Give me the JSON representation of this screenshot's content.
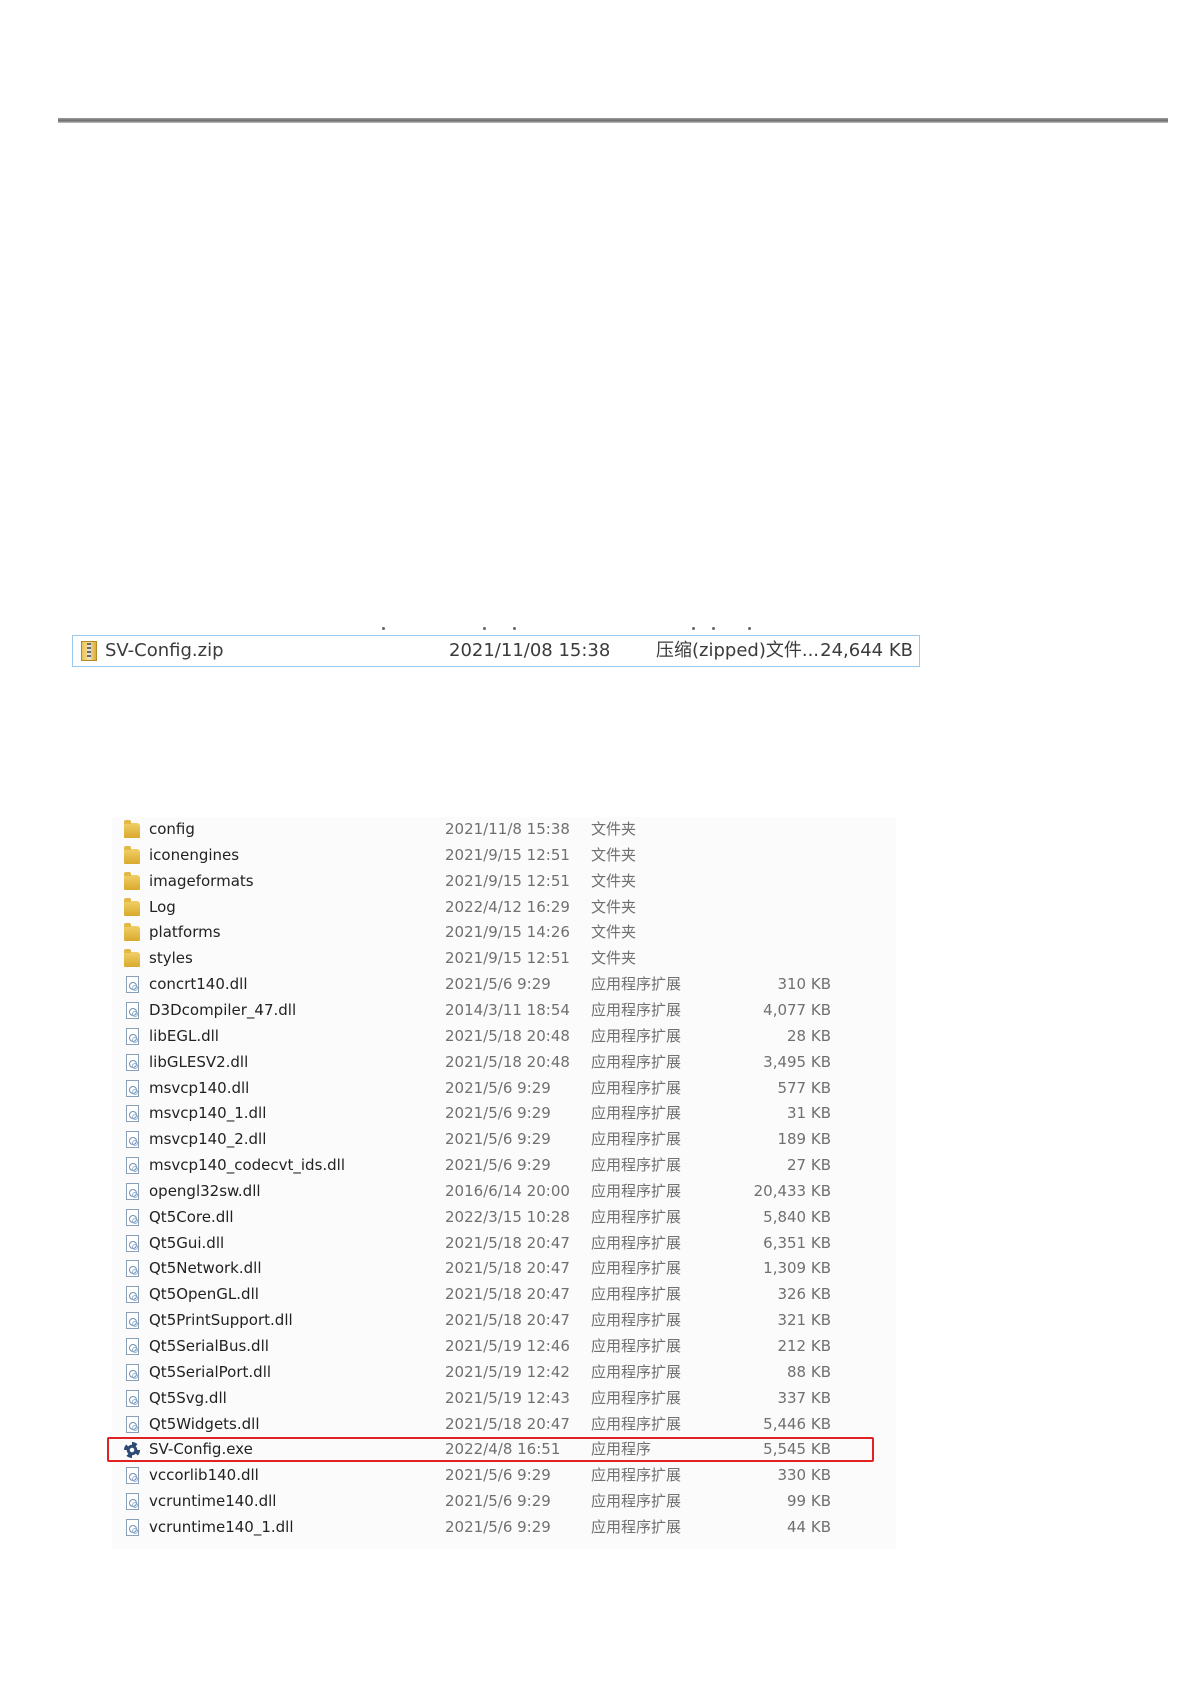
{
  "zip_file": {
    "name": "SV-Config.zip",
    "modified": "2021/11/08 15:38",
    "type": "压缩(zipped)文件...",
    "size": "24,644 KB",
    "icon": "zip-archive-icon"
  },
  "listing": {
    "files": [
      {
        "name": "config",
        "modified": "2021/11/8 15:38",
        "type": "文件夹",
        "size": "",
        "icon": "folder-icon"
      },
      {
        "name": "iconengines",
        "modified": "2021/9/15 12:51",
        "type": "文件夹",
        "size": "",
        "icon": "folder-icon"
      },
      {
        "name": "imageformats",
        "modified": "2021/9/15 12:51",
        "type": "文件夹",
        "size": "",
        "icon": "folder-icon"
      },
      {
        "name": "Log",
        "modified": "2022/4/12 16:29",
        "type": "文件夹",
        "size": "",
        "icon": "folder-icon"
      },
      {
        "name": "platforms",
        "modified": "2021/9/15 14:26",
        "type": "文件夹",
        "size": "",
        "icon": "folder-icon"
      },
      {
        "name": "styles",
        "modified": "2021/9/15 12:51",
        "type": "文件夹",
        "size": "",
        "icon": "folder-icon"
      },
      {
        "name": "concrt140.dll",
        "modified": "2021/5/6 9:29",
        "type": "应用程序扩展",
        "size": "310 KB",
        "icon": "dll-file-icon"
      },
      {
        "name": "D3Dcompiler_47.dll",
        "modified": "2014/3/11 18:54",
        "type": "应用程序扩展",
        "size": "4,077 KB",
        "icon": "dll-file-icon"
      },
      {
        "name": "libEGL.dll",
        "modified": "2021/5/18 20:48",
        "type": "应用程序扩展",
        "size": "28 KB",
        "icon": "dll-file-icon"
      },
      {
        "name": "libGLESV2.dll",
        "modified": "2021/5/18 20:48",
        "type": "应用程序扩展",
        "size": "3,495 KB",
        "icon": "dll-file-icon"
      },
      {
        "name": "msvcp140.dll",
        "modified": "2021/5/6 9:29",
        "type": "应用程序扩展",
        "size": "577 KB",
        "icon": "dll-file-icon"
      },
      {
        "name": "msvcp140_1.dll",
        "modified": "2021/5/6 9:29",
        "type": "应用程序扩展",
        "size": "31 KB",
        "icon": "dll-file-icon"
      },
      {
        "name": "msvcp140_2.dll",
        "modified": "2021/5/6 9:29",
        "type": "应用程序扩展",
        "size": "189 KB",
        "icon": "dll-file-icon"
      },
      {
        "name": "msvcp140_codecvt_ids.dll",
        "modified": "2021/5/6 9:29",
        "type": "应用程序扩展",
        "size": "27 KB",
        "icon": "dll-file-icon"
      },
      {
        "name": "opengl32sw.dll",
        "modified": "2016/6/14 20:00",
        "type": "应用程序扩展",
        "size": "20,433 KB",
        "icon": "dll-file-icon"
      },
      {
        "name": "Qt5Core.dll",
        "modified": "2022/3/15 10:28",
        "type": "应用程序扩展",
        "size": "5,840 KB",
        "icon": "dll-file-icon"
      },
      {
        "name": "Qt5Gui.dll",
        "modified": "2021/5/18 20:47",
        "type": "应用程序扩展",
        "size": "6,351 KB",
        "icon": "dll-file-icon"
      },
      {
        "name": "Qt5Network.dll",
        "modified": "2021/5/18 20:47",
        "type": "应用程序扩展",
        "size": "1,309 KB",
        "icon": "dll-file-icon"
      },
      {
        "name": "Qt5OpenGL.dll",
        "modified": "2021/5/18 20:47",
        "type": "应用程序扩展",
        "size": "326 KB",
        "icon": "dll-file-icon"
      },
      {
        "name": "Qt5PrintSupport.dll",
        "modified": "2021/5/18 20:47",
        "type": "应用程序扩展",
        "size": "321 KB",
        "icon": "dll-file-icon"
      },
      {
        "name": "Qt5SerialBus.dll",
        "modified": "2021/5/19 12:46",
        "type": "应用程序扩展",
        "size": "212 KB",
        "icon": "dll-file-icon"
      },
      {
        "name": "Qt5SerialPort.dll",
        "modified": "2021/5/19 12:42",
        "type": "应用程序扩展",
        "size": "88 KB",
        "icon": "dll-file-icon"
      },
      {
        "name": "Qt5Svg.dll",
        "modified": "2021/5/19 12:43",
        "type": "应用程序扩展",
        "size": "337 KB",
        "icon": "dll-file-icon"
      },
      {
        "name": "Qt5Widgets.dll",
        "modified": "2021/5/18 20:47",
        "type": "应用程序扩展",
        "size": "5,446 KB",
        "icon": "dll-file-icon"
      },
      {
        "name": "SV-Config.exe",
        "modified": "2022/4/8 16:51",
        "type": "应用程序",
        "size": "5,545 KB",
        "icon": "exe-app-icon",
        "highlighted": true
      },
      {
        "name": "vccorlib140.dll",
        "modified": "2021/5/6 9:29",
        "type": "应用程序扩展",
        "size": "330 KB",
        "icon": "dll-file-icon"
      },
      {
        "name": "vcruntime140.dll",
        "modified": "2021/5/6 9:29",
        "type": "应用程序扩展",
        "size": "99 KB",
        "icon": "dll-file-icon"
      },
      {
        "name": "vcruntime140_1.dll",
        "modified": "2021/5/6 9:29",
        "type": "应用程序扩展",
        "size": "44 KB",
        "icon": "dll-file-icon"
      }
    ]
  },
  "colors": {
    "highlight_border": "#e02222",
    "selection_border": "#99c9ef"
  }
}
